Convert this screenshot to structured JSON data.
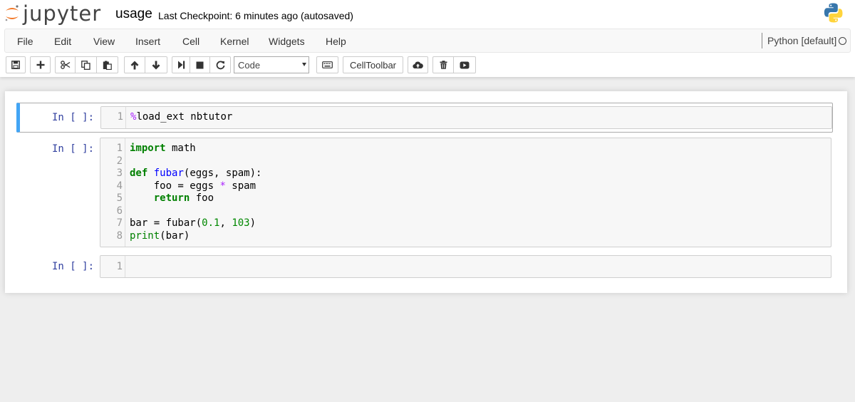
{
  "header": {
    "logo_text": "jupyter",
    "notebook_name": "usage",
    "checkpoint": "Last Checkpoint: 6 minutes ago (autosaved)"
  },
  "menu": {
    "items": [
      "File",
      "Edit",
      "View",
      "Insert",
      "Cell",
      "Kernel",
      "Widgets",
      "Help"
    ],
    "kernel": "Python [default]"
  },
  "toolbar": {
    "cell_type": "Code",
    "celltoolbar_label": "CellToolbar"
  },
  "cells": [
    {
      "prompt": "In [ ]:",
      "line_numbers": [
        "1"
      ],
      "lines": [
        "%load_ext nbtutor"
      ]
    },
    {
      "prompt": "In [ ]:",
      "line_numbers": [
        "1",
        "2",
        "3",
        "4",
        "5",
        "6",
        "7",
        "8"
      ],
      "lines": [
        "import math",
        "",
        "def fubar(eggs, spam):",
        "    foo = eggs * spam",
        "    return foo",
        "",
        "bar = fubar(0.1, 103)",
        "print(bar)"
      ]
    },
    {
      "prompt": "In [ ]:",
      "line_numbers": [
        "1"
      ],
      "lines": [
        ""
      ]
    }
  ],
  "colors": {
    "accent_selected": "#42a5f5",
    "prompt": "#303f9f",
    "keyword": "#008000",
    "def_name": "#0000ff",
    "operator": "#aa22ff"
  }
}
